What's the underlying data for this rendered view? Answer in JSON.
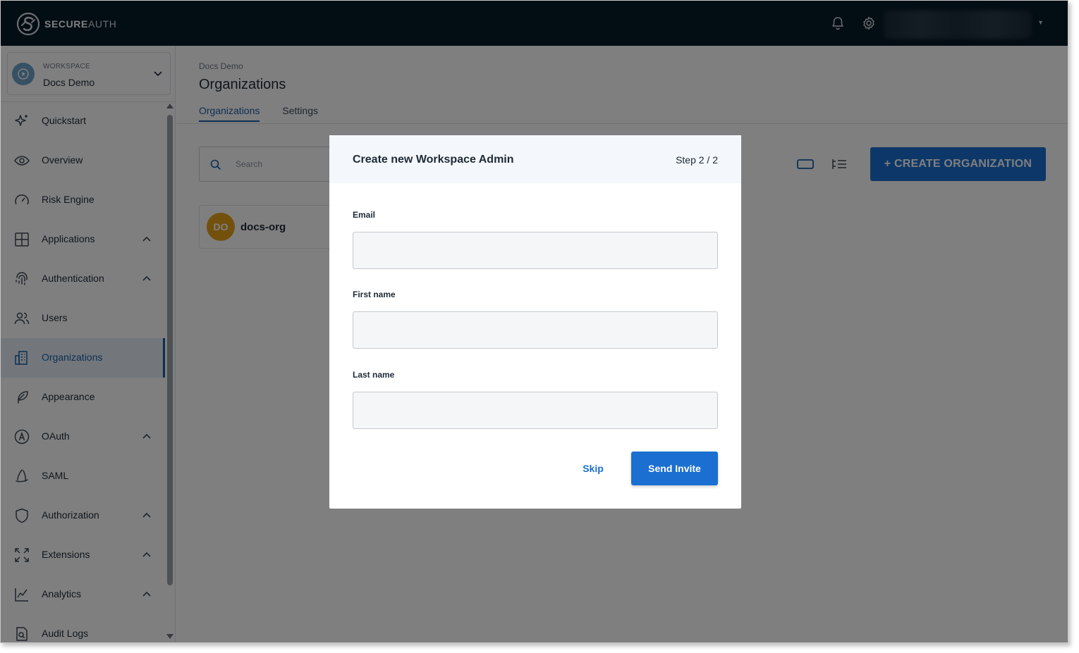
{
  "app": {
    "brand_bold": "SECURE",
    "brand_light": "AUTH"
  },
  "topbar": {
    "notification_icon": "bell-icon",
    "settings_icon": "gear-icon",
    "user_menu_caret": "▾"
  },
  "workspace": {
    "label": "WORKSPACE",
    "name": "Docs Demo"
  },
  "sidebar": {
    "items": [
      {
        "label": "Quickstart",
        "icon": "sparkle-icon",
        "expandable": false
      },
      {
        "label": "Overview",
        "icon": "eye-icon",
        "expandable": false
      },
      {
        "label": "Risk Engine",
        "icon": "gauge-icon",
        "expandable": false
      },
      {
        "label": "Applications",
        "icon": "grid-icon",
        "expandable": true
      },
      {
        "label": "Authentication",
        "icon": "fingerprint-icon",
        "expandable": true
      },
      {
        "label": "Users",
        "icon": "users-icon",
        "expandable": false
      },
      {
        "label": "Organizations",
        "icon": "building-icon",
        "expandable": false,
        "active": true
      },
      {
        "label": "Appearance",
        "icon": "feather-icon",
        "expandable": false
      },
      {
        "label": "OAuth",
        "icon": "oauth-icon",
        "expandable": true
      },
      {
        "label": "SAML",
        "icon": "saml-icon",
        "expandable": false
      },
      {
        "label": "Authorization",
        "icon": "shield-icon",
        "expandable": true
      },
      {
        "label": "Extensions",
        "icon": "expand-icon",
        "expandable": true
      },
      {
        "label": "Analytics",
        "icon": "chart-line-icon",
        "expandable": true
      },
      {
        "label": "Audit Logs",
        "icon": "audit-log-icon",
        "expandable": false
      }
    ]
  },
  "page": {
    "breadcrumb": "Docs Demo",
    "title": "Organizations",
    "tabs": [
      {
        "label": "Organizations",
        "active": true
      },
      {
        "label": "Settings",
        "active": false
      }
    ],
    "search_placeholder": "Search",
    "create_button": "+ CREATE ORGANIZATION",
    "organizations": [
      {
        "initials": "DO",
        "name": "docs-org",
        "color": "#e7a21a"
      }
    ]
  },
  "modal": {
    "title": "Create new Workspace Admin",
    "step": "Step 2 / 2",
    "fields": [
      {
        "label": "Email",
        "value": ""
      },
      {
        "label": "First name",
        "value": ""
      },
      {
        "label": "Last name",
        "value": ""
      }
    ],
    "skip_label": "Skip",
    "submit_label": "Send Invite"
  },
  "colors": {
    "topbar": "#061a29",
    "primary": "#1a6fd1",
    "active_nav": "#1a5fa8"
  }
}
